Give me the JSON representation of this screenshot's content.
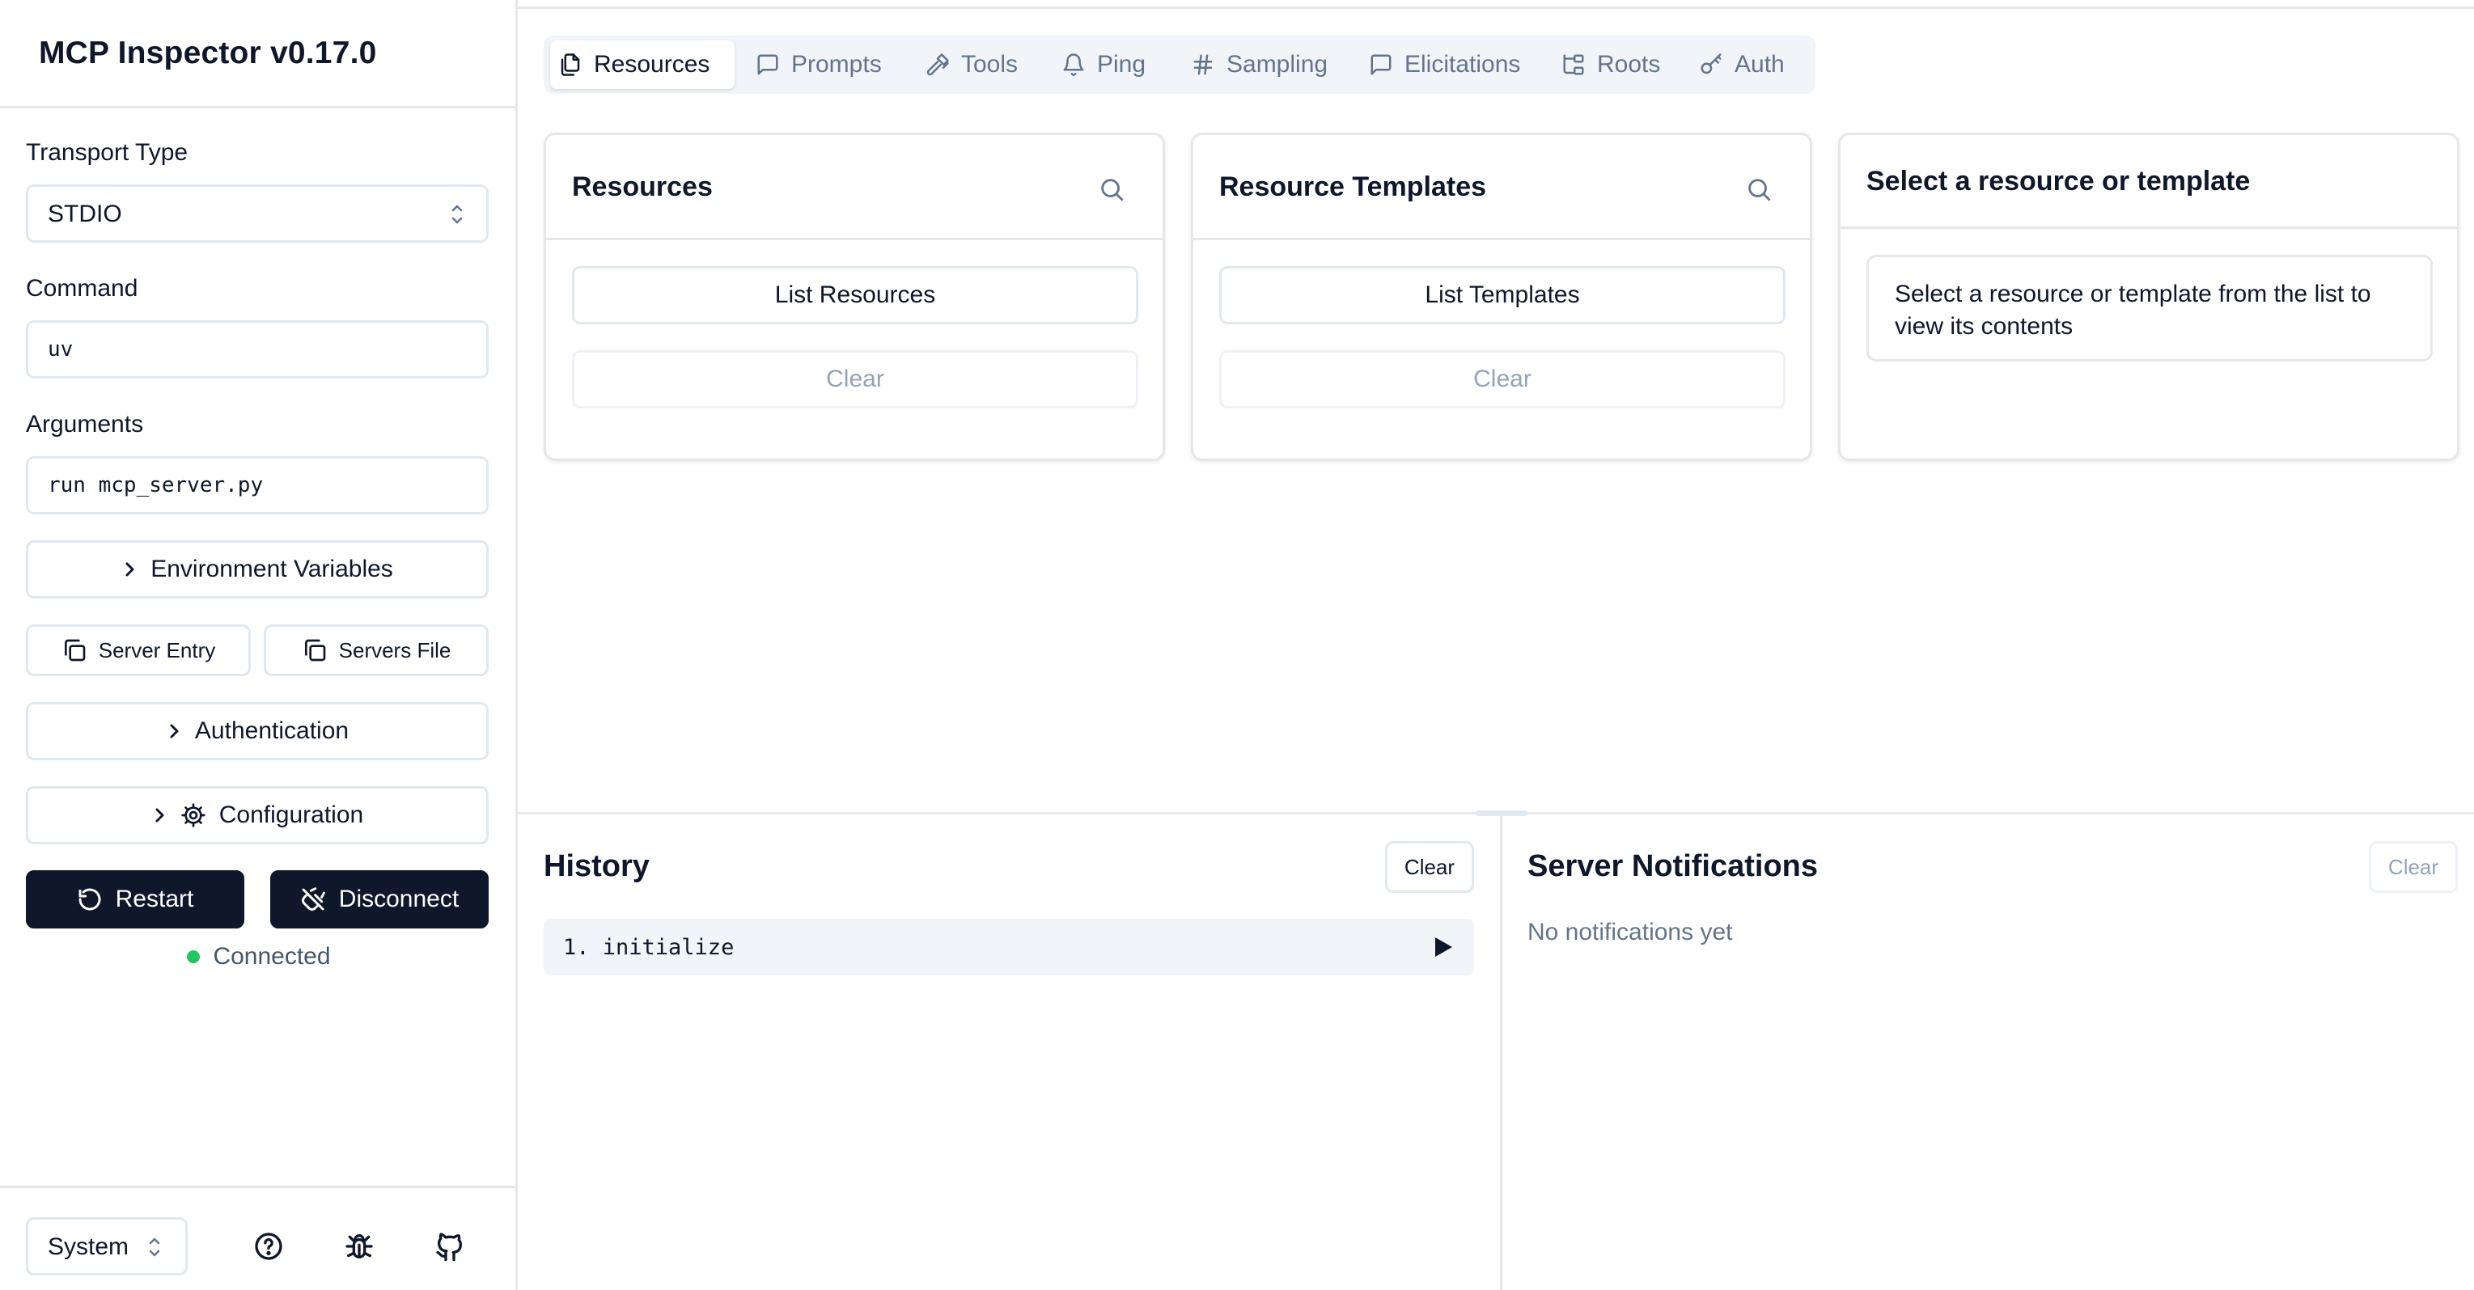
{
  "sidebar": {
    "title": "MCP Inspector v0.17.0",
    "transport": {
      "label": "Transport Type",
      "value": "STDIO"
    },
    "command": {
      "label": "Command",
      "value": "uv"
    },
    "arguments": {
      "label": "Arguments",
      "value": "run mcp_server.py"
    },
    "env_button": "Environment Variables",
    "server_entry_button": "Server Entry",
    "servers_file_button": "Servers File",
    "auth_button": "Authentication",
    "config_button": "Configuration",
    "restart_button": "Restart",
    "disconnect_button": "Disconnect",
    "status": "Connected",
    "theme": "System"
  },
  "tabs": [
    {
      "label": "Resources",
      "icon": "files-icon",
      "active": true
    },
    {
      "label": "Prompts",
      "icon": "message-square-icon"
    },
    {
      "label": "Tools",
      "icon": "hammer-icon"
    },
    {
      "label": "Ping",
      "icon": "bell-icon"
    },
    {
      "label": "Sampling",
      "icon": "hash-icon"
    },
    {
      "label": "Elicitations",
      "icon": "message-square-icon"
    },
    {
      "label": "Roots",
      "icon": "folder-tree-icon"
    },
    {
      "label": "Auth",
      "icon": "key-icon"
    }
  ],
  "resources": {
    "title": "Resources",
    "list_button": "List Resources",
    "clear_button": "Clear"
  },
  "templates": {
    "title": "Resource Templates",
    "list_button": "List Templates",
    "clear_button": "Clear"
  },
  "detail": {
    "title": "Select a resource or template",
    "hint": "Select a resource or template from the list to view its contents"
  },
  "history": {
    "title": "History",
    "clear_button": "Clear",
    "items": [
      "1. initialize"
    ]
  },
  "notifications": {
    "title": "Server Notifications",
    "clear_button": "Clear",
    "empty": "No notifications yet"
  },
  "colors": {
    "accent_dark": "#0f172a",
    "status_green": "#22c55e",
    "muted": "#64748b"
  }
}
